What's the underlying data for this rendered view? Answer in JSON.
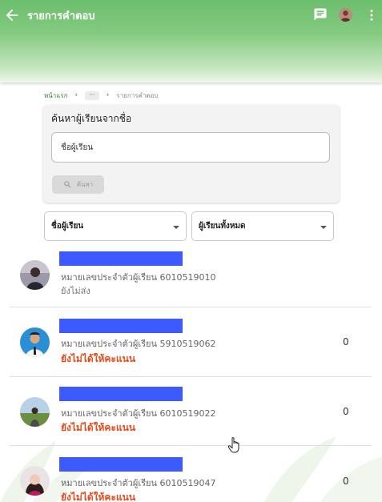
{
  "header": {
    "title": "รายการคำตอบ",
    "icons": [
      "back-arrow-icon",
      "chat-icon",
      "user-avatar",
      "more-vert-icon"
    ]
  },
  "breadcrumb": {
    "home": "หน้าแรก",
    "more": "···",
    "current": "รายการคำตอบ"
  },
  "search": {
    "title": "ค้นหาผู้เรียนจากชื่อ",
    "placeholder": "ชื่อผู้เรียน",
    "button_label": "ค้นหา"
  },
  "filters": {
    "sort_by": "ชื่อผู้เรียน",
    "group": "ผู้เรียนทั้งหมด"
  },
  "students": [
    {
      "id_label": "หมายเลขประจำตัวผู้เรียน 6010519010",
      "status": "ยังไม่ส่ง",
      "score": ""
    },
    {
      "id_label": "หมายเลขประจำตัวผู้เรียน 5910519062",
      "status": "ยังไม่ได้ให้คะแนน",
      "score": "0"
    },
    {
      "id_label": "หมายเลขประจำตัวผู้เรียน 6010519022",
      "status": "ยังไม่ได้ให้คะแนน",
      "score": "0"
    },
    {
      "id_label": "หมายเลขประจำตัวผู้เรียน 6010519047",
      "status": "ยังไม่ได้ให้คะแนน",
      "score": "0"
    }
  ],
  "colors": {
    "header_green": "#6dbe6f",
    "name_redaction": "#3d5afe",
    "status_red": "#e64a19"
  }
}
